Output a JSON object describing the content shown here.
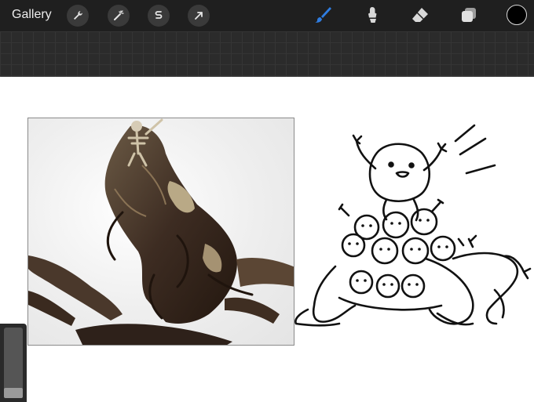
{
  "toolbar": {
    "gallery_label": "Gallery",
    "left_tools": [
      "wrench-icon",
      "magic-wand-icon",
      "selection-s-icon",
      "transform-arrow-icon"
    ],
    "right_tools": [
      "brush-icon",
      "smudge-icon",
      "eraser-icon",
      "layers-icon"
    ],
    "active_tool": "brush",
    "active_color": "#2f7de1",
    "current_color": "#000000"
  },
  "canvas": {
    "background": "#ffffff"
  },
  "sidebar": {
    "brush_size": 0.1
  }
}
